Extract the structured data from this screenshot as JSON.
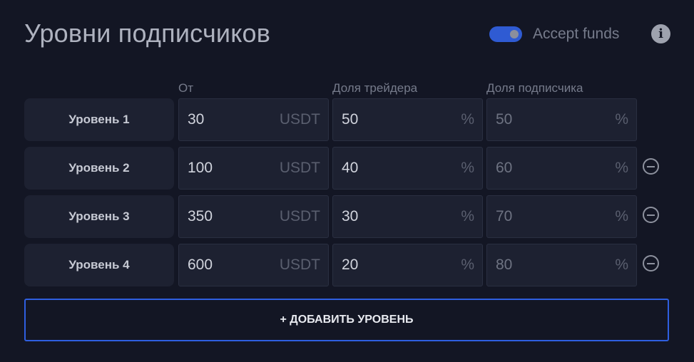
{
  "header": {
    "title": "Уровни подписчиков",
    "toggle_label": "Accept funds",
    "toggle_on": true,
    "info_icon": "info-icon"
  },
  "columns": {
    "from": "От",
    "trader_share": "Доля трейдера",
    "subscriber_share": "Доля подписчика"
  },
  "levels": [
    {
      "label": "Уровень 1",
      "from": "30",
      "from_unit": "USDT",
      "trader": "50",
      "trader_unit": "%",
      "subscriber": "50",
      "subscriber_unit": "%",
      "removable": false
    },
    {
      "label": "Уровень 2",
      "from": "100",
      "from_unit": "USDT",
      "trader": "40",
      "trader_unit": "%",
      "subscriber": "60",
      "subscriber_unit": "%",
      "removable": true
    },
    {
      "label": "Уровень 3",
      "from": "350",
      "from_unit": "USDT",
      "trader": "30",
      "trader_unit": "%",
      "subscriber": "70",
      "subscriber_unit": "%",
      "removable": true
    },
    {
      "label": "Уровень 4",
      "from": "600",
      "from_unit": "USDT",
      "trader": "20",
      "trader_unit": "%",
      "subscriber": "80",
      "subscriber_unit": "%",
      "removable": true
    }
  ],
  "add_button": "+ ДОБАВИТЬ УРОВЕНЬ",
  "colors": {
    "background": "#131624",
    "accent": "#2f5fe0",
    "field_bg": "#1d2131"
  }
}
